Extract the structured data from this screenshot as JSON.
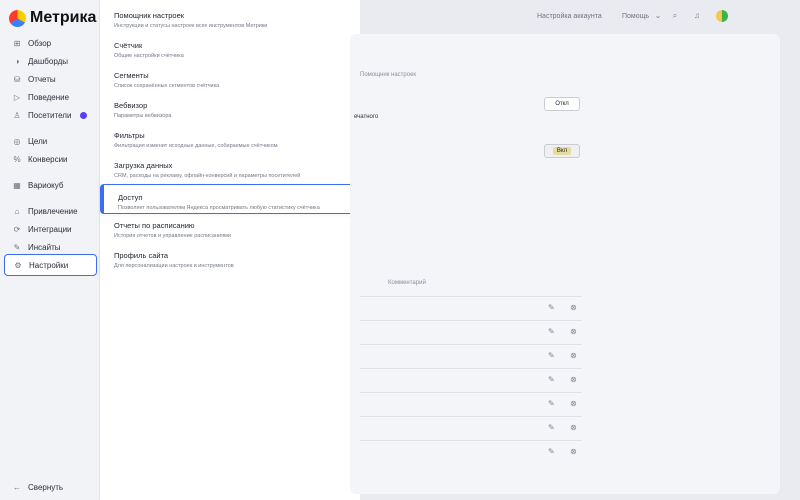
{
  "app": {
    "logo_text": "Метрика"
  },
  "sidebar": {
    "items": [
      {
        "label": "Обзор",
        "icon": "grid-icon"
      },
      {
        "label": "Дашборды",
        "icon": "dashboard-icon"
      },
      {
        "label": "Отчеты",
        "icon": "reports-icon"
      },
      {
        "label": "Поведение",
        "icon": "play-icon"
      },
      {
        "label": "Посетители",
        "icon": "user-icon"
      },
      {
        "label": "Цели",
        "icon": "target-icon"
      },
      {
        "label": "Конверсии",
        "icon": "percent-icon"
      },
      {
        "label": "Вариокуб",
        "icon": "cube-icon"
      },
      {
        "label": "Привлечение",
        "icon": "attraction-icon"
      },
      {
        "label": "Интеграции",
        "icon": "integration-icon"
      },
      {
        "label": "Инсайты",
        "icon": "insight-icon"
      },
      {
        "label": "Настройки",
        "icon": "gear-icon"
      }
    ],
    "collapse_label": "Свернуть"
  },
  "settings_menu": {
    "items": [
      {
        "title": "Помощник настроек",
        "subtitle": "Инструкции и статусы настроек всех инструментов Метрики"
      },
      {
        "title": "Счётчик",
        "subtitle": "Общие настройки счётчика"
      },
      {
        "title": "Сегменты",
        "subtitle": "Список сохранённых сегментов счётчика"
      },
      {
        "title": "Вебвизор",
        "subtitle": "Параметры вебвизора"
      },
      {
        "title": "Фильтры",
        "subtitle": "Фильтрация изменит исходные данные, собираемые счётчиком"
      },
      {
        "title": "Загрузка данных",
        "subtitle": "CRM, расходы на рекламу, офлайн-конверсий и параметры посетителей"
      },
      {
        "title": "Доступ",
        "subtitle": "Позволяет пользователям Яндекса просматривать любую статистику счётчика"
      },
      {
        "title": "Отчеты по расписанию",
        "subtitle": "История отчетов и управление расписаниями"
      },
      {
        "title": "Профиль сайта",
        "subtitle": "Для персонализации настроек и инструментов"
      }
    ]
  },
  "topbar": {
    "counter_settings": "Настройка аккаунта",
    "help": "Помощь"
  },
  "content": {
    "breadcrumb": "Помощник настроек",
    "toggle_off": "Откл",
    "toggle_on": "Вкл",
    "fragment": "ечатного",
    "column_comment": "Комментарий"
  }
}
